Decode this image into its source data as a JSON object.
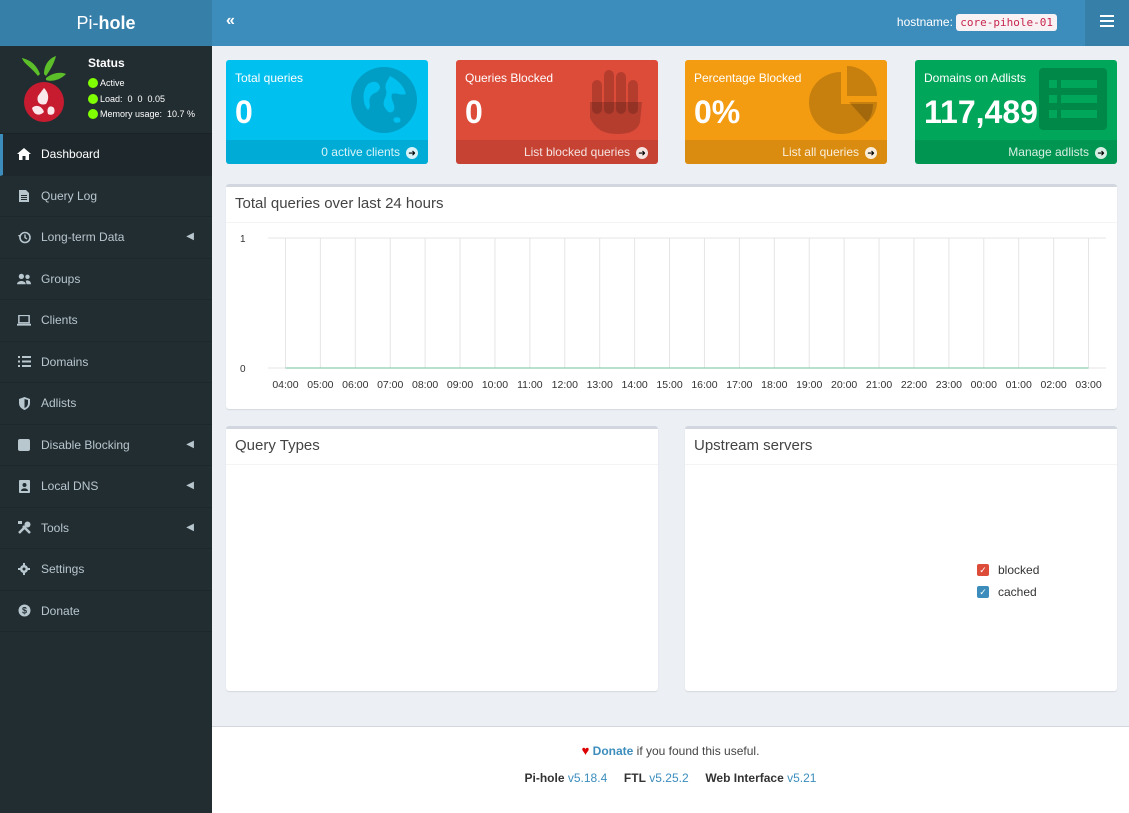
{
  "header": {
    "logo_prefix": "Pi-",
    "logo_bold": "hole",
    "collapse_icon": "«",
    "hostname_label": "hostname:",
    "hostname_value": "core-pihole-01",
    "menu_icon": "≡"
  },
  "status": {
    "title": "Status",
    "active": "Active",
    "load": "Load:  0  0  0.05",
    "memory": "Memory usage:  10.7 %"
  },
  "sidebar": {
    "items": [
      {
        "label": "Dashboard",
        "icon": "home-icon"
      },
      {
        "label": "Query Log",
        "icon": "file-icon"
      },
      {
        "label": "Long-term Data",
        "icon": "history-icon"
      },
      {
        "label": "Groups",
        "icon": "users-icon"
      },
      {
        "label": "Clients",
        "icon": "laptop-icon"
      },
      {
        "label": "Domains",
        "icon": "list-icon"
      },
      {
        "label": "Adlists",
        "icon": "shield-icon"
      },
      {
        "label": "Disable Blocking",
        "icon": "stop-icon"
      },
      {
        "label": "Local DNS",
        "icon": "address-book-icon"
      },
      {
        "label": "Tools",
        "icon": "tools-icon"
      },
      {
        "label": "Settings",
        "icon": "gear-icon"
      },
      {
        "label": "Donate",
        "icon": "donate-icon"
      }
    ]
  },
  "boxes": {
    "total": {
      "label": "Total queries",
      "value": "0",
      "footer": "0 active clients"
    },
    "blocked": {
      "label": "Queries Blocked",
      "value": "0",
      "footer": "List blocked queries"
    },
    "percent": {
      "label": "Percentage Blocked",
      "value": "0%",
      "footer": "List all queries"
    },
    "adlists": {
      "label": "Domains on Adlists",
      "value": "117,489",
      "footer": "Manage adlists"
    }
  },
  "panels": {
    "queries_title": "Total queries over last 24 hours",
    "query_types_title": "Query Types",
    "upstream_title": "Upstream servers",
    "legend": [
      "blocked",
      "cached"
    ]
  },
  "chart_data": {
    "type": "area",
    "categories": [
      "04:00",
      "05:00",
      "06:00",
      "07:00",
      "08:00",
      "09:00",
      "10:00",
      "11:00",
      "12:00",
      "13:00",
      "14:00",
      "15:00",
      "16:00",
      "17:00",
      "18:00",
      "19:00",
      "20:00",
      "21:00",
      "22:00",
      "23:00",
      "00:00",
      "01:00",
      "02:00",
      "03:00"
    ],
    "values": [
      0,
      0,
      0,
      0,
      0,
      0,
      0,
      0,
      0,
      0,
      0,
      0,
      0,
      0,
      0,
      0,
      0,
      0,
      0,
      0,
      0,
      0,
      0,
      0
    ],
    "yticks": [
      "0",
      "1"
    ],
    "ylim": [
      0,
      1
    ],
    "grid": true
  },
  "footer": {
    "donate": "Donate",
    "donate_suffix": " if you found this useful.",
    "pihole_label": "Pi-hole",
    "pihole_version": "v5.18.4",
    "ftl_label": "FTL",
    "ftl_version": "v5.25.2",
    "web_label": "Web Interface",
    "web_version": "v5.21"
  },
  "colors": {
    "aqua": "#00c0ef",
    "red": "#dd4b39",
    "yellow": "#f39c12",
    "green": "#00a65a",
    "navbar": "#3c8dbc",
    "sidebar": "#222d32"
  }
}
